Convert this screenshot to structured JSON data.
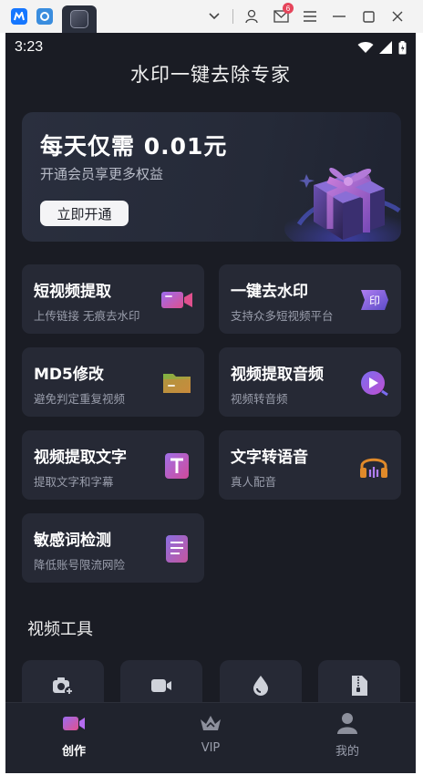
{
  "status_bar": {
    "time": "3:23"
  },
  "host": {
    "mail_badge": "6"
  },
  "app": {
    "title": "水印一键去除专家"
  },
  "banner": {
    "title": "每天仅需 0.01元",
    "subtitle": "开通会员享更多权益",
    "button_label": "立即开通"
  },
  "features": [
    {
      "title": "短视频提取",
      "subtitle": "上传链接 无痕去水印",
      "icon": "video-camera-icon"
    },
    {
      "title": "一键去水印",
      "subtitle": "支持众多短视频平台",
      "icon": "stamp-icon"
    },
    {
      "title": "MD5修改",
      "subtitle": "避免判定重复视频",
      "icon": "folder-icon"
    },
    {
      "title": "视频提取音频",
      "subtitle": "视频转音频",
      "icon": "audio-disc-icon"
    },
    {
      "title": "视频提取文字",
      "subtitle": "提取文字和字幕",
      "icon": "text-t-icon"
    },
    {
      "title": "文字转语音",
      "subtitle": "真人配音",
      "icon": "headphones-icon"
    },
    {
      "title": "敏感词检测",
      "subtitle": "降低账号限流网险",
      "icon": "document-list-icon"
    }
  ],
  "video_tools": {
    "title": "视频工具",
    "items": [
      {
        "icon": "camera-add-icon"
      },
      {
        "icon": "video-icon"
      },
      {
        "icon": "droplet-icon"
      },
      {
        "icon": "zip-file-icon"
      }
    ]
  },
  "tabbar": {
    "items": [
      {
        "label": "创作",
        "icon": "create-video-icon",
        "active": true
      },
      {
        "label": "VIP",
        "icon": "crown-icon",
        "active": false
      },
      {
        "label": "我的",
        "icon": "profile-icon",
        "active": false
      }
    ]
  },
  "colors": {
    "background": "#1a1c24",
    "card": "#262935",
    "accent_purple": "#8b5cf6",
    "accent_pink": "#e44d8a"
  }
}
